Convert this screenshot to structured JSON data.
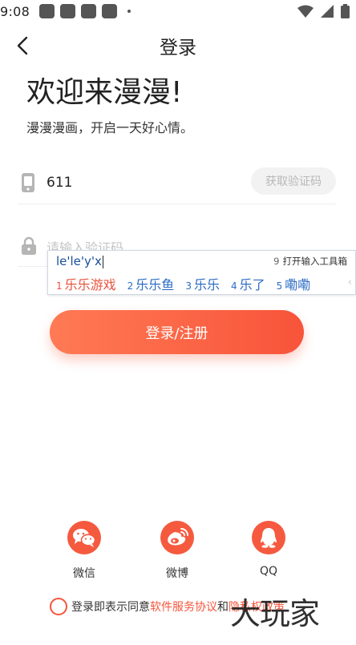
{
  "status_bar": {
    "time": "9:08"
  },
  "header": {
    "title": "登录"
  },
  "welcome": {
    "title": "欢迎来漫漫!",
    "subtitle": "漫漫漫画，开启一天好心情。"
  },
  "phone": {
    "value": "611",
    "code_button": "获取验证码"
  },
  "code": {
    "placeholder": "请输入验证码"
  },
  "ime": {
    "composition": "le'le'y'x",
    "tools_num": "9",
    "tools_label": "打开输入工具箱",
    "candidates": [
      {
        "num": "1",
        "text": "乐乐游戏"
      },
      {
        "num": "2",
        "text": "乐乐鱼"
      },
      {
        "num": "3",
        "text": "乐乐"
      },
      {
        "num": "4",
        "text": "乐了"
      },
      {
        "num": "5",
        "text": "嘞嘞"
      }
    ],
    "more": "‹"
  },
  "login_button": "登录/注册",
  "social": [
    {
      "label": "微信",
      "icon": "wechat-icon"
    },
    {
      "label": "微博",
      "icon": "weibo-icon"
    },
    {
      "label": "QQ",
      "icon": "qq-icon"
    }
  ],
  "agreement": {
    "prefix": "登录即表示同意",
    "service_link": "软件服务协议",
    "and": "和",
    "privacy_link": "隐私权政策"
  },
  "watermark": "大玩家",
  "colors": {
    "accent": "#f5553c",
    "accent_light": "#ff7a55",
    "ime_blue": "#2b6cc4"
  }
}
